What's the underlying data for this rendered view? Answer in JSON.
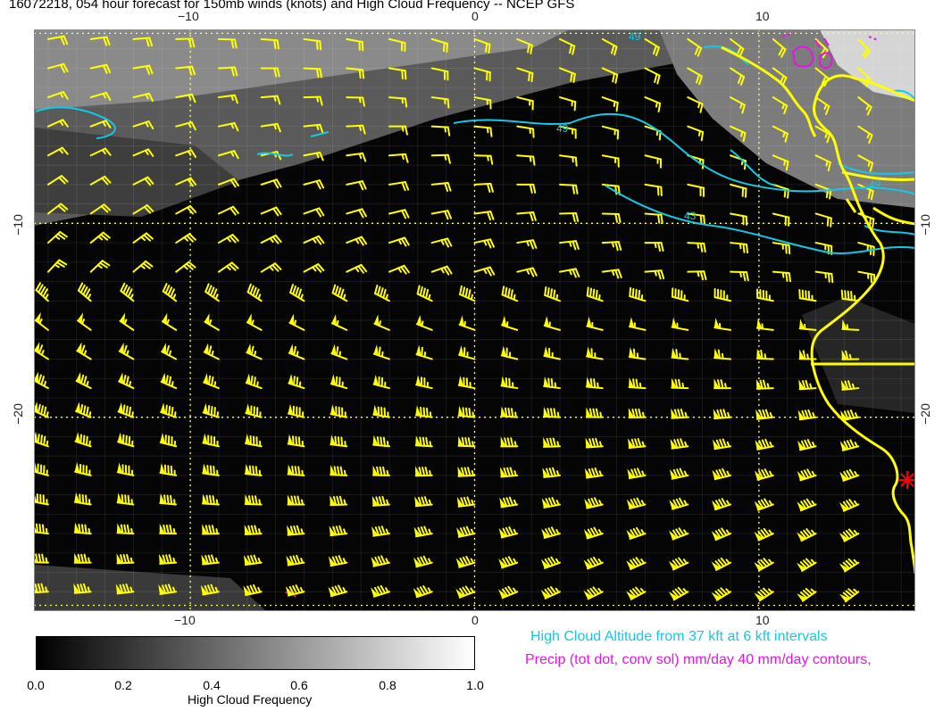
{
  "title": "16072218, 054 hour forecast for 150mb winds (knots) and High Cloud Frequency -- NCEP GFS",
  "axes": {
    "top_ticks": [
      "−10",
      "0",
      "10"
    ],
    "bottom_ticks": [
      "−10",
      "0",
      "10"
    ],
    "left_ticks": [
      "−10",
      "−20"
    ],
    "right_ticks": [
      "−10",
      "−20"
    ],
    "lon_range": [
      -15.5,
      15.5
    ],
    "lat_range": [
      -30,
      0
    ]
  },
  "contours": {
    "labels": [
      "49",
      "49",
      "49",
      "43"
    ],
    "color": "#14c8e6"
  },
  "colorbar": {
    "ticks": [
      "0.0",
      "0.2",
      "0.4",
      "0.6",
      "0.8",
      "1.0"
    ],
    "label": "High Cloud Frequency",
    "from_color": "#000000",
    "to_color": "#ffffff"
  },
  "legend": {
    "altitude_text": "High Cloud Altitude from 37 kft at 6 kft intervals",
    "precip_text": "Precip (tot dot, conv sol) mm/day 40 mm/day contours,"
  },
  "colors": {
    "barb": "#ffff00",
    "coast": "#ffff00",
    "contour": "#14c8e6",
    "precip": "#e614e6",
    "marker": "#ff0000",
    "grid": "#ffff66"
  }
}
